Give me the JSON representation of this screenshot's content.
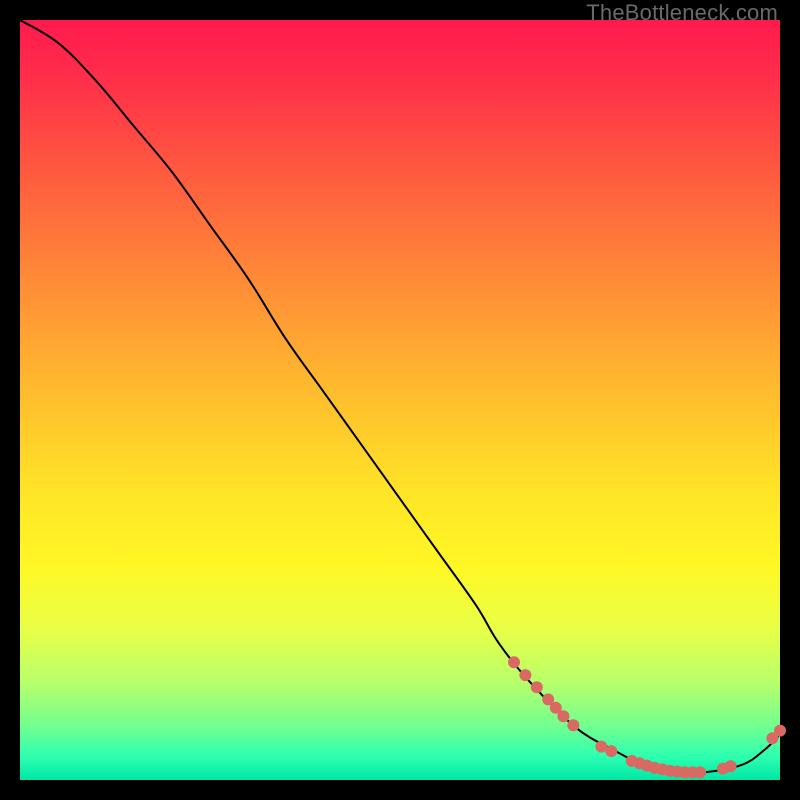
{
  "watermark": "TheBottleneck.com",
  "chart_data": {
    "type": "line",
    "title": "",
    "xlabel": "",
    "ylabel": "",
    "xlim": [
      0,
      100
    ],
    "ylim": [
      0,
      100
    ],
    "series": [
      {
        "name": "curve",
        "x": [
          0,
          5,
          10,
          15,
          20,
          25,
          30,
          35,
          40,
          45,
          50,
          55,
          60,
          63,
          67,
          73,
          78,
          82,
          86,
          90,
          95,
          98,
          100
        ],
        "y": [
          100,
          97,
          92,
          86,
          80,
          73,
          66,
          58,
          51,
          44,
          37,
          30,
          23,
          18,
          13,
          7,
          4,
          2,
          1,
          1,
          2,
          4,
          6
        ]
      }
    ],
    "markers": [
      {
        "x": 65.0,
        "y": 15.5
      },
      {
        "x": 66.5,
        "y": 13.8
      },
      {
        "x": 68.0,
        "y": 12.2
      },
      {
        "x": 69.5,
        "y": 10.6
      },
      {
        "x": 70.5,
        "y": 9.5
      },
      {
        "x": 71.5,
        "y": 8.4
      },
      {
        "x": 72.8,
        "y": 7.2
      },
      {
        "x": 76.5,
        "y": 4.4
      },
      {
        "x": 77.8,
        "y": 3.8
      },
      {
        "x": 80.5,
        "y": 2.5
      },
      {
        "x": 81.5,
        "y": 2.2
      },
      {
        "x": 82.5,
        "y": 1.9
      },
      {
        "x": 83.5,
        "y": 1.6
      },
      {
        "x": 84.5,
        "y": 1.4
      },
      {
        "x": 85.5,
        "y": 1.2
      },
      {
        "x": 86.5,
        "y": 1.1
      },
      {
        "x": 87.5,
        "y": 1.0
      },
      {
        "x": 88.5,
        "y": 1.0
      },
      {
        "x": 89.5,
        "y": 1.0
      },
      {
        "x": 92.5,
        "y": 1.5
      },
      {
        "x": 93.5,
        "y": 1.8
      },
      {
        "x": 99.0,
        "y": 5.5
      },
      {
        "x": 100.0,
        "y": 6.5
      }
    ],
    "marker_radius_px": 6,
    "grid": false,
    "legend": false
  }
}
